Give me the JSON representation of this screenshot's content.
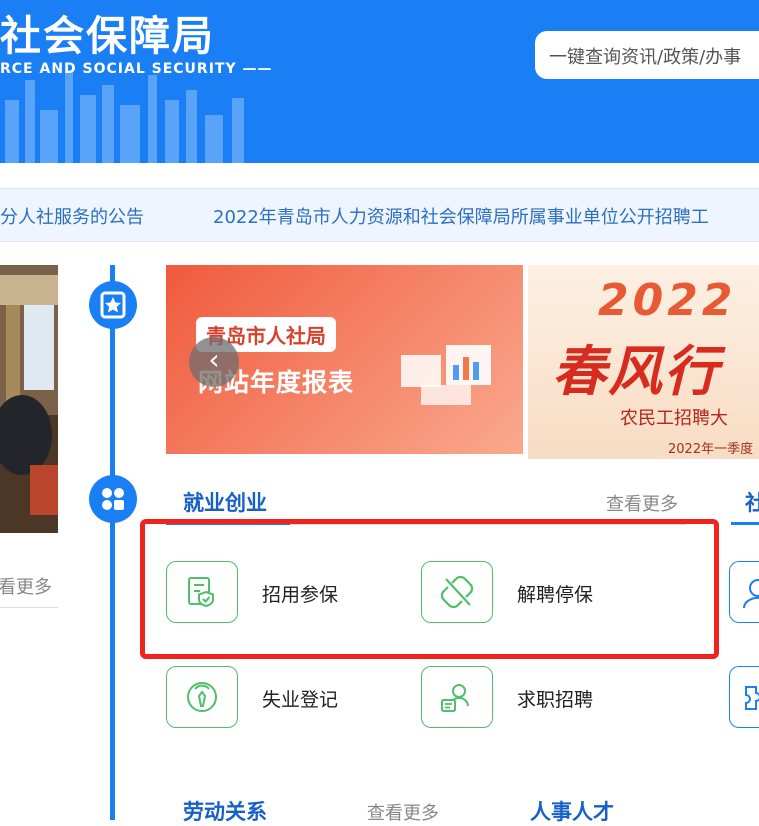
{
  "header": {
    "logo_cn": "社会保障局",
    "logo_en": "RCE AND SOCIAL SECURITY ——",
    "search_placeholder": "一键查询资讯/政策/办事"
  },
  "notices": [
    "分人社服务的公告",
    "2022年青岛市人力资源和社会保障局所属事业单位公开招聘工"
  ],
  "left_panel": {
    "more": "看更多"
  },
  "banners": {
    "banner1": {
      "tag": "青岛市人社局",
      "title": "网站年度报表"
    },
    "banner2": {
      "year": "2022",
      "main": "春风行",
      "sub": "农民工招聘大",
      "date": "2022年一季度"
    }
  },
  "sections": {
    "employment": {
      "title": "就业创业",
      "more": "查看更多",
      "items": [
        {
          "label": "招用参保",
          "icon": "document-shield-icon"
        },
        {
          "label": "解聘停保",
          "icon": "broken-link-icon"
        },
        {
          "label": "失业登记",
          "icon": "person-tie-icon"
        },
        {
          "label": "求职招聘",
          "icon": "person-card-icon"
        }
      ]
    },
    "right_partial": {
      "title": "社"
    },
    "labor": {
      "title": "劳动关系",
      "more": "查看更多"
    },
    "personnel": {
      "title": "人事人才"
    }
  },
  "colors": {
    "brand": "#1a7ff5",
    "service_green": "#4fbf6a",
    "highlight": "#f0231d"
  }
}
